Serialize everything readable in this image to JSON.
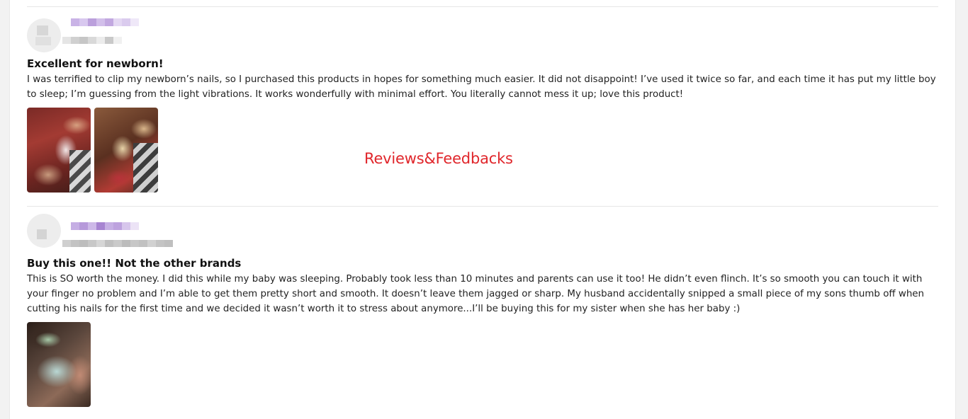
{
  "watermark": "Reviews&Feedbacks",
  "reviews": [
    {
      "title": "Excellent for newborn!",
      "body": "I was terrified to clip my newborn’s nails, so I purchased this products in hopes for something much easier. It did not disappoint! I’ve used it twice so far, and each time it has put my little boy to sleep; I’m guessing from the light vibrations. It works wonderfully with minimal effort. You literally cannot mess it up; love this product!",
      "photo_count": 2
    },
    {
      "title": "Buy this one!! Not the other brands",
      "body": "This is SO worth the money. I did this while my baby was sleeping. Probably took less than 10 minutes and parents can use it too! He didn’t even flinch. It’s so smooth you can touch it with your finger no problem and I’m able to get them pretty short and smooth. It doesn’t leave them jagged or sharp. My husband accidentally snipped a small piece of my sons thumb off when cutting his nails for the first time and we decided it wasn’t worth it to stress about anymore...I’ll be buying this for my sister when she has her baby :)",
      "photo_count": 1
    }
  ],
  "colors": {
    "name_blur": "#b79ad8",
    "meta_blur": "#c4c4c4",
    "watermark": "#e0262b"
  }
}
